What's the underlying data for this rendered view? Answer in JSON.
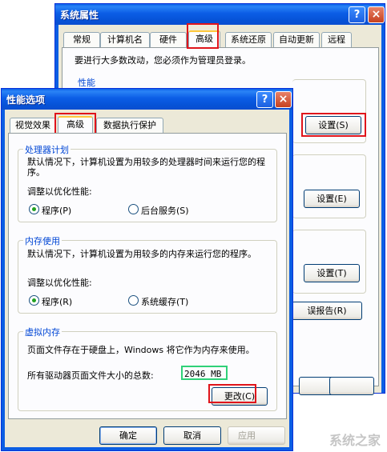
{
  "back_window": {
    "title": "系统属性",
    "help_btn": "?",
    "close_btn": "×",
    "tabs": [
      "常规",
      "计算机名",
      "硬件",
      "高级",
      "系统还原",
      "自动更新",
      "远程"
    ],
    "admin_notice": "要进行大多数改动，您必须作为管理员登录。",
    "performance_label": "性能",
    "settings_btn_1": "设置(S)",
    "settings_btn_2": "设置(E)",
    "settings_btn_3": "设置(T)",
    "error_report_btn": "误报告(R)"
  },
  "front_window": {
    "title": "性能选项",
    "help_btn": "?",
    "close_btn": "×",
    "tabs": [
      "视觉效果",
      "高级",
      "数据执行保护"
    ],
    "processor": {
      "label": "处理器计划",
      "desc": "默认情况下，计算机设置为用较多的处理器时间来运行您的程序。",
      "optimize_label": "调整以优化性能:",
      "option_programs": "程序(P)",
      "option_background": "后台服务(S)",
      "selected": "程序(P)"
    },
    "memory": {
      "label": "内存使用",
      "desc": "默认情况下，计算机设置为用较多的内存来运行您的程序。",
      "optimize_label": "调整以优化性能:",
      "option_programs": "程序(R)",
      "option_cache": "系统缓存(T)",
      "selected": "程序(R)"
    },
    "virtual_memory": {
      "label": "虚拟内存",
      "desc": "页面文件存在于硬盘上，Windows 将它作为内存来使用。",
      "total_label": "所有驱动器页面文件大小的总数:",
      "total_value": "2046 MB",
      "change_btn": "更改(C)"
    },
    "footer": {
      "ok": "确定",
      "cancel": "取消",
      "apply": "应用"
    }
  },
  "watermark": "系统之家"
}
